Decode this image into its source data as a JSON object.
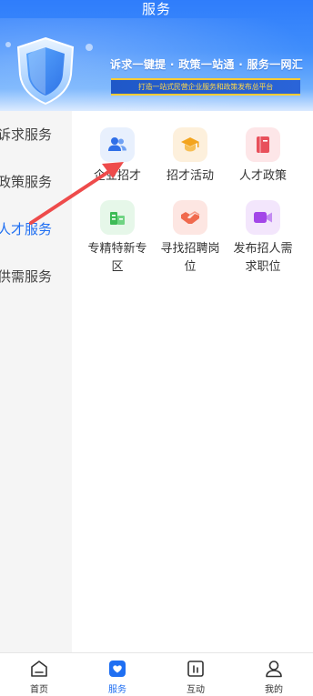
{
  "header": {
    "title": "服务",
    "slogan": "诉求一键提 · 政策一站通 · 服务一网汇",
    "subtitle": "打造一站式民营企业服务和政策发布总平台"
  },
  "sidebar": {
    "items": [
      {
        "label": "诉求服务",
        "active": false
      },
      {
        "label": "政策服务",
        "active": false
      },
      {
        "label": "人才服务",
        "active": true
      },
      {
        "label": "供需服务",
        "active": false
      }
    ]
  },
  "services": [
    {
      "label": "企业招才",
      "icon": "users-icon",
      "bg": "#e8f0fd",
      "color": "#2f6fe8"
    },
    {
      "label": "招才活动",
      "icon": "graduation-cap-icon",
      "bg": "#fdf0dc",
      "color": "#f3a41d"
    },
    {
      "label": "人才政策",
      "icon": "book-icon",
      "bg": "#fde6e8",
      "color": "#e8505b"
    },
    {
      "label": "专精特新专区",
      "icon": "building-icon",
      "bg": "#e6f7e9",
      "color": "#3dbb56"
    },
    {
      "label": "寻找招聘岗位",
      "icon": "handshake-icon",
      "bg": "#fde6e2",
      "color": "#f06a4e"
    },
    {
      "label": "发布招人需求职位",
      "icon": "video-icon",
      "bg": "#f3e6fc",
      "color": "#a346e8"
    }
  ],
  "tabbar": {
    "items": [
      {
        "label": "首页",
        "icon": "home-icon",
        "active": false
      },
      {
        "label": "服务",
        "icon": "service-heart-icon",
        "active": true
      },
      {
        "label": "互动",
        "icon": "interact-icon",
        "active": false
      },
      {
        "label": "我的",
        "icon": "profile-icon",
        "active": false
      }
    ]
  },
  "colors": {
    "accent": "#1f6ff2",
    "banner": "#3f8dfb",
    "annotation_arrow": "#ee4b4b"
  }
}
